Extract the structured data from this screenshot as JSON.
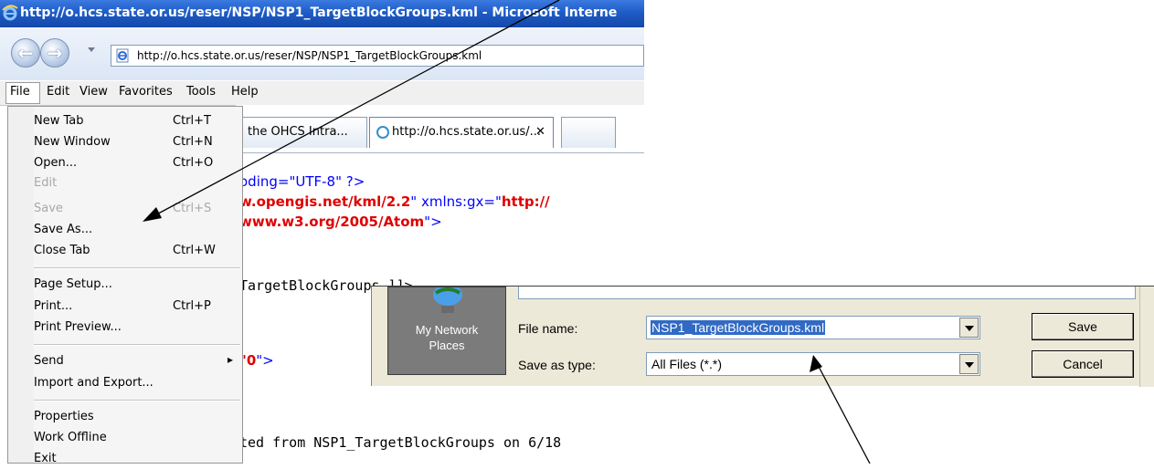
{
  "window": {
    "title": "http://o.hcs.state.or.us/reser/NSP/NSP1_TargetBlockGroups.kml - Microsoft Interne"
  },
  "navigation": {
    "back_icon": "back-arrow-icon",
    "forward_icon": "forward-arrow-icon",
    "address": "http://o.hcs.state.or.us/reser/NSP/NSP1_TargetBlockGroups.kml"
  },
  "menubar": {
    "items": [
      "File",
      "Edit",
      "View",
      "Favorites",
      "Tools",
      "Help"
    ]
  },
  "tabs": [
    {
      "label": "the OHCS Intra..."
    },
    {
      "label": "http://o.hcs.state.or.us/...",
      "close": "✕"
    }
  ],
  "content": {
    "line1": "oding=\"UTF-8\" ?>",
    "line2_a": "w.opengis.net/kml/2.2",
    "line2_b": "\" xmlns:gx=\"",
    "line2_c": "http://",
    "line3_a": "www.w3.org/2005/Atom",
    "line3_b": "\">",
    "line4": "TargetBlockGroups ]]>",
    "line5_a": "\"0",
    "line5_b": "\">",
    "line6": "ted from NSP1_TargetBlockGroups on 6/18"
  },
  "file_menu": {
    "items": [
      {
        "label": "New Tab",
        "shortcut": "Ctrl+T"
      },
      {
        "label": "New Window",
        "shortcut": "Ctrl+N"
      },
      {
        "label": "Open...",
        "shortcut": "Ctrl+O"
      },
      {
        "label": "Edit",
        "shortcut": ""
      },
      {
        "label": "Save",
        "shortcut": "Ctrl+S"
      },
      {
        "label": "Save As...",
        "shortcut": ""
      },
      {
        "label": "Close Tab",
        "shortcut": "Ctrl+W"
      },
      {
        "label": "Page Setup...",
        "shortcut": ""
      },
      {
        "label": "Print...",
        "shortcut": "Ctrl+P"
      },
      {
        "label": "Print Preview...",
        "shortcut": ""
      },
      {
        "label": "Send",
        "shortcut": ""
      },
      {
        "label": "Import and Export...",
        "shortcut": ""
      },
      {
        "label": "Properties",
        "shortcut": ""
      },
      {
        "label": "Work Offline",
        "shortcut": ""
      },
      {
        "label": "Exit",
        "shortcut": ""
      }
    ],
    "submenu_arrow": "▸"
  },
  "save_dialog": {
    "place_label_1": "My Network",
    "place_label_2": "Places",
    "filename_label": "File name:",
    "filename_value": "NSP1_TargetBlockGroups.kml",
    "type_label": "Save as type:",
    "type_value": "All Files (*.*)",
    "save_button": "Save",
    "cancel_button": "Cancel"
  },
  "colors": {
    "titlebar": "#1e5cc8",
    "selection": "#316ac5",
    "xml_blue": "#0000ff",
    "xml_red": "#e00000"
  }
}
